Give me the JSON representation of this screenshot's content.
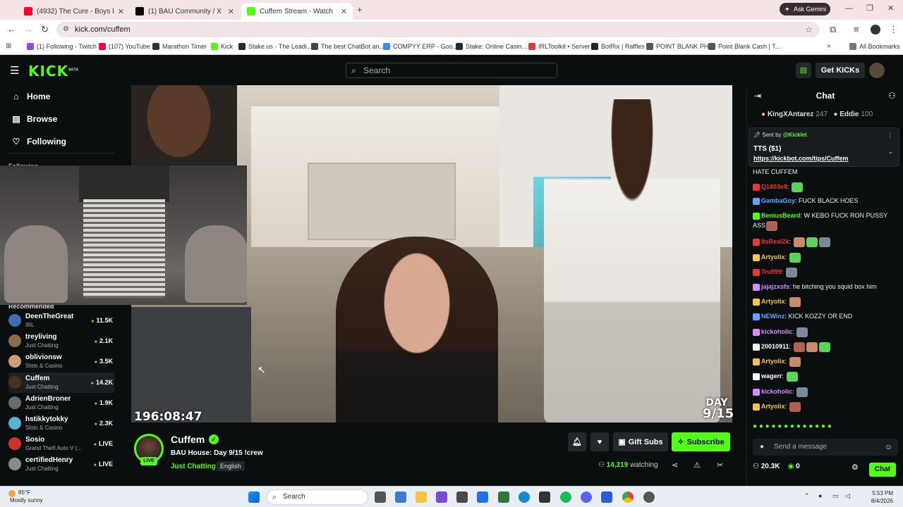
{
  "browser": {
    "tabs": [
      {
        "label": "(4932) The Cure - Boys Don't Cry",
        "color": "#ff0033"
      },
      {
        "label": "(1) BAU Community / X",
        "color": "#000000"
      },
      {
        "label": "Cuffem Stream - Watch Live",
        "color": "#53fc18"
      }
    ],
    "ask_gemini": "Ask Gemini",
    "url": "kick.com/cuffem",
    "bookmarks": [
      {
        "label": "(1) Following - Twitch",
        "color": "#9146ff"
      },
      {
        "label": "(107) YouTube",
        "color": "#ff0033"
      },
      {
        "label": "Marathon Timer",
        "color": "#333333"
      },
      {
        "label": "Kick",
        "color": "#53fc18"
      },
      {
        "label": "Stake.us - The Leadi...",
        "color": "#1a2c38"
      },
      {
        "label": "The best ChatBot an...",
        "color": "#444444"
      },
      {
        "label": "COMPYY ERP - Goo...",
        "color": "#4285f4"
      },
      {
        "label": "Stake: Online Casin...",
        "color": "#1a2c38"
      },
      {
        "label": "IRLToolkit • Server",
        "color": "#e53935"
      },
      {
        "label": "BotRix | Raffles",
        "color": "#222222"
      },
      {
        "label": "POINT BLANK PH",
        "color": "#555555"
      },
      {
        "label": "Point Blank Cash | T...",
        "color": "#555555"
      }
    ],
    "all_bookmarks": "All Bookmarks"
  },
  "header": {
    "logo": "KICK",
    "logo_beta": "BETA",
    "search_placeholder": "Search",
    "get_kicks": "Get KICKs"
  },
  "sidebar": {
    "nav": [
      {
        "label": "Home",
        "icon": "home-icon"
      },
      {
        "label": "Browse",
        "icon": "browse-icon"
      },
      {
        "label": "Following",
        "icon": "heart-icon"
      }
    ],
    "following_heading": "Following",
    "recommended_heading": "Recommended",
    "recommended": [
      {
        "name": "DeenTheGreat",
        "category": "IRL",
        "viewers": "11.5K",
        "color": "#3b6fb0"
      },
      {
        "name": "treyliving",
        "category": "Just Chatting",
        "viewers": "2.1K",
        "color": "#8a6a4a"
      },
      {
        "name": "oblivionsw",
        "category": "Slots & Casino",
        "viewers": "3.5K",
        "color": "#c9a07a"
      },
      {
        "name": "Cuffem",
        "category": "Just Chatting",
        "viewers": "14.2K",
        "color": "#4a3022"
      },
      {
        "name": "AdrienBroner",
        "category": "Just Chatting",
        "viewers": "1.9K",
        "color": "#6a6a6a"
      },
      {
        "name": "hstikkytokky",
        "category": "Slots & Casino",
        "viewers": "2.3K",
        "color": "#5ab0d0"
      },
      {
        "name": "Sosio",
        "category": "Grand Theft Auto V (...",
        "viewers": "LIVE",
        "color": "#d03030"
      },
      {
        "name": "certifiedHenry",
        "category": "Just Chatting",
        "viewers": "LIVE",
        "color": "#8a8a8a"
      }
    ]
  },
  "video": {
    "timer": "196:08:47",
    "day_label": "DAY",
    "day_value": "9/15"
  },
  "stream": {
    "channel": "Cuffem",
    "live_badge": "LIVE",
    "title": "BAU House: Day 9/15 !crew",
    "category": "Just Chatting",
    "language": "English",
    "gift_subs": "Gift Subs",
    "subscribe": "Subscribe",
    "viewers": "14,219",
    "watching_label": "watching"
  },
  "chat": {
    "title": "Chat",
    "gifters": [
      {
        "name": "KingXAntarez",
        "value": "247"
      },
      {
        "name": "Eddie",
        "value": "100"
      }
    ],
    "pinned": {
      "sent_by": "Sent by",
      "sender": "@Kicklet",
      "text": "TTS ($1)",
      "link": "https://kickbot.com/tips/Cuffem"
    },
    "messages": [
      {
        "user": "",
        "text": "HATE CUFFEM",
        "color": "#ffffff",
        "emotes": 0
      },
      {
        "user": "Q1803e8",
        "text": "",
        "color": "#e53935",
        "emotes": 1
      },
      {
        "user": "GambaGoy",
        "text": "FUCK BLACK HOES",
        "color": "#5aa9ff",
        "emotes": 0
      },
      {
        "user": "BeniusBeard",
        "text": "W KEBO  FUCK RON PUSSY ASS",
        "color": "#53fc18",
        "emotes": 1
      },
      {
        "user": "ItsReal2k",
        "text": "",
        "color": "#e53935",
        "emotes": 3
      },
      {
        "user": "Artyolix",
        "text": "",
        "color": "#f4c542",
        "emotes": 1
      },
      {
        "user": "Tru999",
        "text": "",
        "color": "#e53935",
        "emotes": 1
      },
      {
        "user": "jajajzxsfs",
        "text": "he bitching you squid box him",
        "color": "#d08cff",
        "emotes": 0
      },
      {
        "user": "Artyolix",
        "text": "",
        "color": "#f4c542",
        "emotes": 1
      },
      {
        "user": "NEWinz",
        "text": "KICK KOZZY OR END",
        "color": "#5aa9ff",
        "emotes": 0
      },
      {
        "user": "kickoholic",
        "text": "",
        "color": "#d08cff",
        "emotes": 1
      },
      {
        "user": "20010911",
        "text": "",
        "color": "#ffffff",
        "emotes": 3
      },
      {
        "user": "Artyolix",
        "text": "",
        "color": "#f4c542",
        "emotes": 1
      },
      {
        "user": "wagerr",
        "text": "",
        "color": "#ffffff",
        "emotes": 1
      },
      {
        "user": "kickoholic",
        "text": "",
        "color": "#d08cff",
        "emotes": 1
      },
      {
        "user": "Artyolix",
        "text": "",
        "color": "#f4c542",
        "emotes": 1
      }
    ],
    "input_placeholder": "Send a message",
    "kicks_count": "20.3K",
    "points": "0",
    "send_button": "Chat"
  },
  "taskbar": {
    "temp": "85°F",
    "weather": "Mostly sunny",
    "search": "Search",
    "time": "5:53 PM",
    "date": "8/4/2026"
  },
  "colors": {
    "accent": "#53fc18",
    "background": "#0b0e0f"
  }
}
